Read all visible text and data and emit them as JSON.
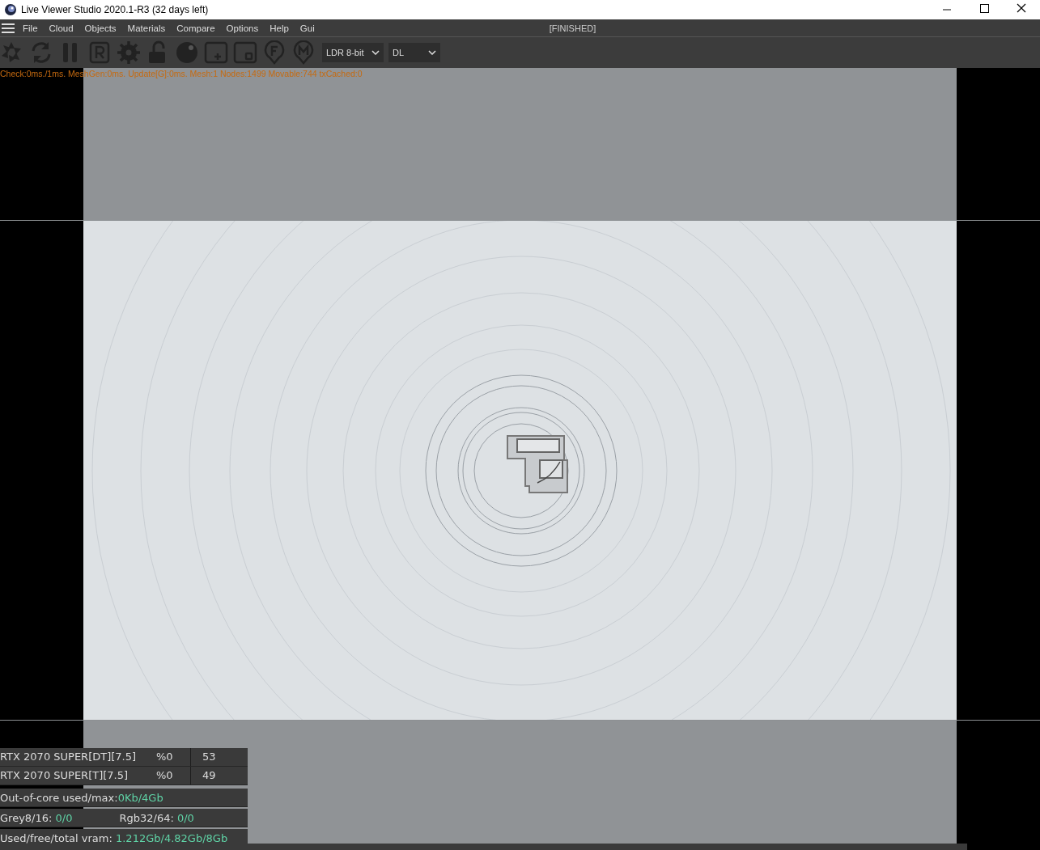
{
  "window": {
    "title": "Live Viewer Studio 2020.1-R3 (32 days left)"
  },
  "menu": {
    "items": [
      "File",
      "Cloud",
      "Objects",
      "Materials",
      "Compare",
      "Options",
      "Help",
      "Gui"
    ],
    "status": "[FINISHED]"
  },
  "toolbar": {
    "dropdowns": [
      {
        "value": "LDR 8-bit"
      },
      {
        "value": "DL"
      }
    ]
  },
  "viewport": {
    "stats_line": "Check:0ms./1ms. MeshGen:0ms. Update[G]:0ms. Mesh:1 Nodes:1499 Movable:744 txCached:0"
  },
  "gpu_table": {
    "rows": [
      {
        "device": "RTX 2070 SUPER[DT][7.5]",
        "usage": "%0",
        "temperature": "53"
      },
      {
        "device": "RTX 2070 SUPER[T][7.5]",
        "usage": "%0",
        "temperature": "49"
      }
    ]
  },
  "memory": [
    {
      "items": [
        {
          "label": "Out-of-core used/max:",
          "value": "0Kb/4Gb"
        }
      ]
    },
    {
      "items": [
        {
          "label": "Grey8/16: ",
          "value": "0/0"
        },
        {
          "label": "Rgb32/64: ",
          "value": "0/0"
        }
      ]
    },
    {
      "items": [
        {
          "label": "Used/free/total vram: ",
          "value": "1.212Gb/4.82Gb/8Gb"
        }
      ]
    }
  ]
}
